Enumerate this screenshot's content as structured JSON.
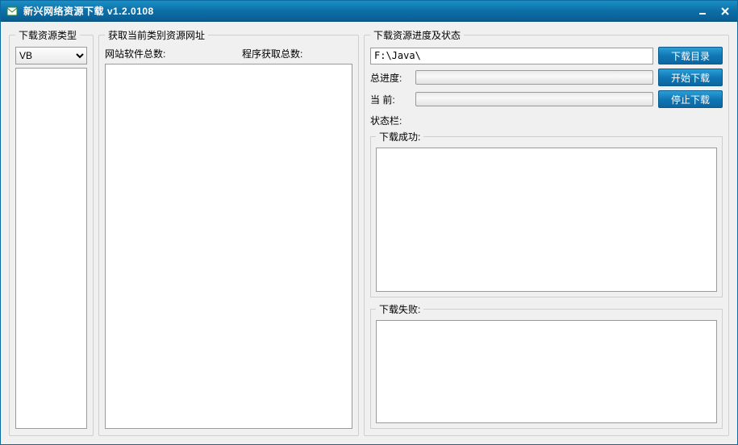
{
  "window": {
    "title": "新兴网络资源下载  v1.2.0108"
  },
  "type_panel": {
    "legend": "下载资源类型",
    "selected": "VB"
  },
  "mid_panel": {
    "legend": "获取当前类别资源网址",
    "label_site_total": "网站软件总数:",
    "label_fetch_total": "程序获取总数:"
  },
  "right_panel": {
    "legend": "下载资源进度及状态",
    "path_value": "F:\\Java\\",
    "btn_dir": "下载目录",
    "btn_start": "开始下载",
    "btn_stop": "停止下载",
    "label_total_progress": "总进度:",
    "label_current": "当    前:",
    "label_status_bar": "状态栏:",
    "label_success": "下载成功:",
    "label_fail": "下载失败:"
  }
}
